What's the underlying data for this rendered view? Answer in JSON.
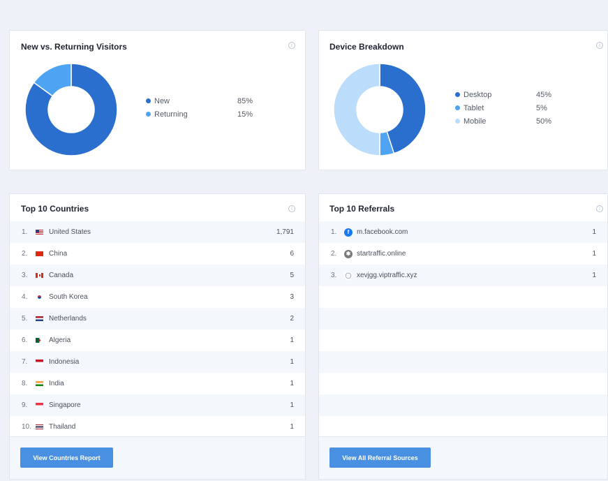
{
  "visitors": {
    "title": "New vs. Returning Visitors",
    "items": [
      {
        "label": "New",
        "pct": "85%",
        "value": 85,
        "color": "#2a6fce"
      },
      {
        "label": "Returning",
        "pct": "15%",
        "value": 15,
        "color": "#4ea4f2"
      }
    ]
  },
  "devices": {
    "title": "Device Breakdown",
    "items": [
      {
        "label": "Desktop",
        "pct": "45%",
        "value": 45,
        "color": "#2a6fce"
      },
      {
        "label": "Tablet",
        "pct": "5%",
        "value": 5,
        "color": "#4ea4f2"
      },
      {
        "label": "Mobile",
        "pct": "50%",
        "value": 50,
        "color": "#bcdcfb"
      }
    ]
  },
  "countries": {
    "title": "Top 10 Countries",
    "button": "View Countries Report",
    "rows": [
      {
        "rank": "1.",
        "name": "United States",
        "value": "1,791",
        "flag": "us"
      },
      {
        "rank": "2.",
        "name": "China",
        "value": "6",
        "flag": "cn"
      },
      {
        "rank": "3.",
        "name": "Canada",
        "value": "5",
        "flag": "ca"
      },
      {
        "rank": "4.",
        "name": "South Korea",
        "value": "3",
        "flag": "kr"
      },
      {
        "rank": "5.",
        "name": "Netherlands",
        "value": "2",
        "flag": "nl"
      },
      {
        "rank": "6.",
        "name": "Algeria",
        "value": "1",
        "flag": "dz"
      },
      {
        "rank": "7.",
        "name": "Indonesia",
        "value": "1",
        "flag": "id"
      },
      {
        "rank": "8.",
        "name": "India",
        "value": "1",
        "flag": "in"
      },
      {
        "rank": "9.",
        "name": "Singapore",
        "value": "1",
        "flag": "sg"
      },
      {
        "rank": "10.",
        "name": "Thailand",
        "value": "1",
        "flag": "th"
      }
    ]
  },
  "referrals": {
    "title": "Top 10 Referrals",
    "button": "View All Referral Sources",
    "rows": [
      {
        "rank": "1.",
        "name": "m.facebook.com",
        "value": "1",
        "icon": "facebook-icon"
      },
      {
        "rank": "2.",
        "name": "startraffic.online",
        "value": "1",
        "icon": "spider-icon"
      },
      {
        "rank": "3.",
        "name": "xevjgg.viptraffic.xyz",
        "value": "1",
        "icon": "globe-icon"
      }
    ]
  },
  "info_glyph": "i"
}
